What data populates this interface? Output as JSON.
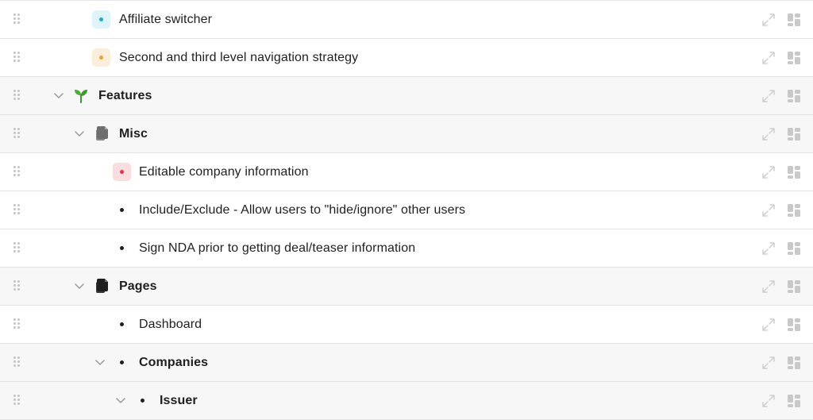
{
  "rows": [
    {
      "label": "Affiliate switcher",
      "bold": false,
      "group": false,
      "marker": "colorbox",
      "box_bg": "#dff3fb",
      "dot_color": "#1ea7d8"
    },
    {
      "label": "Second and third level navigation strategy",
      "bold": false,
      "group": false,
      "marker": "colorbox",
      "box_bg": "#fbeedd",
      "dot_color": "#f0a030"
    },
    {
      "label": "Features",
      "bold": true,
      "group": true,
      "marker": "sprout-icon",
      "expanded": true
    },
    {
      "label": "Misc",
      "bold": true,
      "group": true,
      "marker": "page-icon-gray",
      "expanded": true
    },
    {
      "label": "Editable company information",
      "bold": false,
      "group": false,
      "marker": "colorbox",
      "box_bg": "#fbdde0",
      "dot_color": "#e8354a"
    },
    {
      "label": "Include/Exclude - Allow users to \"hide/ignore\" other users",
      "bold": false,
      "group": false,
      "marker": "bullet"
    },
    {
      "label": "Sign NDA prior to getting deal/teaser information",
      "bold": false,
      "group": false,
      "marker": "bullet"
    },
    {
      "label": "Pages",
      "bold": true,
      "group": true,
      "marker": "page-icon-dark",
      "expanded": true
    },
    {
      "label": "Dashboard",
      "bold": false,
      "group": false,
      "marker": "bullet"
    },
    {
      "label": "Companies",
      "bold": true,
      "group": true,
      "marker": "bullet",
      "expanded": true
    },
    {
      "label": "Issuer",
      "bold": true,
      "group": true,
      "marker": "bullet",
      "expanded": true
    }
  ],
  "icons": {
    "drag": "drag-handle-icon",
    "chevron": "chevron-down-icon",
    "expand": "expand-icon",
    "layout": "layout-icon"
  },
  "colors": {
    "row_group_bg": "#f7f7f7",
    "row_bg": "#ffffff",
    "border": "#e3e3e3",
    "icon_muted": "#c8c8c8",
    "sprout_green": "#3e9a2e"
  }
}
